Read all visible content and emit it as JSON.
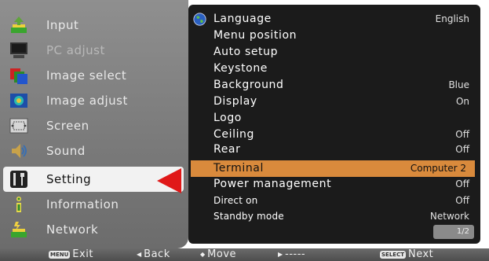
{
  "left_menu": [
    {
      "label": "Input",
      "icon": "input-icon",
      "state": "normal"
    },
    {
      "label": "PC adjust",
      "icon": "monitor-icon",
      "state": "dim"
    },
    {
      "label": "Image select",
      "icon": "image-select-icon",
      "state": "normal"
    },
    {
      "label": "Image adjust",
      "icon": "image-adjust-icon",
      "state": "normal"
    },
    {
      "label": "Screen",
      "icon": "screen-icon",
      "state": "normal"
    },
    {
      "label": "Sound",
      "icon": "speaker-icon",
      "state": "normal"
    },
    {
      "label": "Setting",
      "icon": "tools-icon",
      "state": "selected"
    },
    {
      "label": "Information",
      "icon": "info-icon",
      "state": "normal"
    },
    {
      "label": "Network",
      "icon": "network-icon",
      "state": "normal"
    }
  ],
  "settings": [
    {
      "label": "Language",
      "value": "English"
    },
    {
      "label": "Menu position",
      "value": ""
    },
    {
      "label": "Auto setup",
      "value": ""
    },
    {
      "label": "Keystone",
      "value": ""
    },
    {
      "label": "Background",
      "value": "Blue"
    },
    {
      "label": "Display",
      "value": "On"
    },
    {
      "label": "Logo",
      "value": ""
    },
    {
      "label": "Ceiling",
      "value": "Off"
    },
    {
      "label": "Rear",
      "value": "Off"
    },
    {
      "label": "Terminal",
      "value": "Computer 2"
    },
    {
      "label": "Power management",
      "value": "Off"
    },
    {
      "label": "Direct on",
      "value": "Off"
    },
    {
      "label": "Standby mode",
      "value": "Network"
    }
  ],
  "page_indicator": "1/2",
  "bottom_bar": {
    "exit_key": "MENU",
    "exit_label": "Exit",
    "back_arrow": "◀",
    "back_label": "Back",
    "move_arrow": "◆",
    "move_label": "Move",
    "next_arrow": "▶",
    "next_value": "-----",
    "select_key": "SELECT",
    "next_label": "Next"
  },
  "colors": {
    "highlight": "#d98a3c",
    "pointer": "#e01818",
    "panel": "#1b1b1b"
  }
}
